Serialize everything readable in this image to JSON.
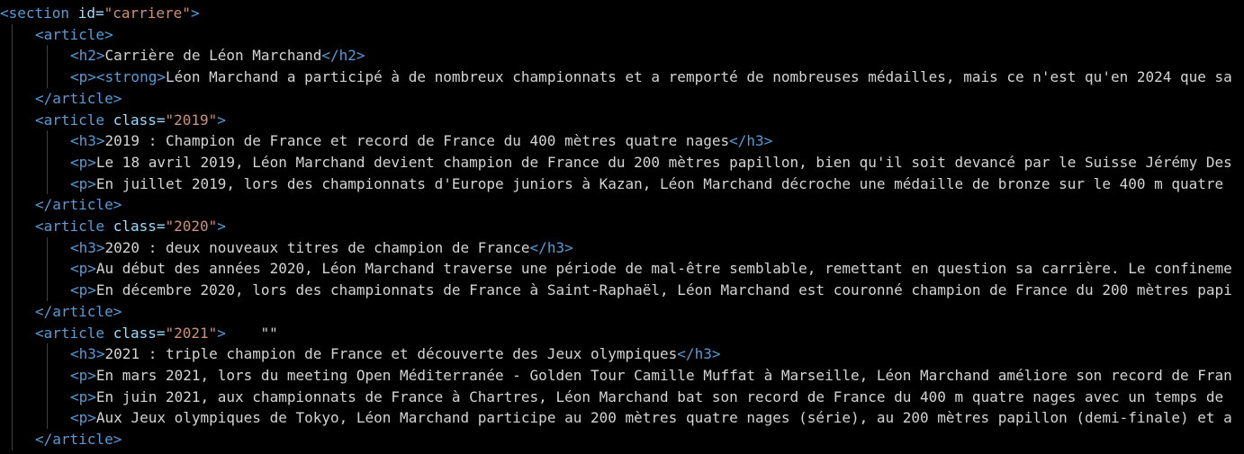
{
  "editor": {
    "lines": [
      {
        "indent": 0,
        "segments": [
          {
            "t": "<section ",
            "c": "tag"
          },
          {
            "t": "id=",
            "c": "attr"
          },
          {
            "t": "\"carriere\"",
            "c": "str"
          },
          {
            "t": ">",
            "c": "tag"
          }
        ]
      },
      {
        "indent": 1,
        "segments": [
          {
            "t": "<article>",
            "c": "tag"
          }
        ]
      },
      {
        "indent": 2,
        "segments": [
          {
            "t": "<h2>",
            "c": "tag"
          },
          {
            "t": "Carrière de Léon Marchand",
            "c": "txt"
          },
          {
            "t": "</h2>",
            "c": "tag"
          }
        ]
      },
      {
        "indent": 2,
        "segments": [
          {
            "t": "<p><strong>",
            "c": "tag"
          },
          {
            "t": "Léon Marchand a participé à de nombreux championnats et a remporté de nombreuses médailles, mais ce n'est qu'en 2024 que sa",
            "c": "txt"
          }
        ]
      },
      {
        "indent": 1,
        "segments": [
          {
            "t": "</article>",
            "c": "tag"
          }
        ]
      },
      {
        "indent": 1,
        "segments": [
          {
            "t": "<article ",
            "c": "tag"
          },
          {
            "t": "class=",
            "c": "attr"
          },
          {
            "t": "\"2019\"",
            "c": "str"
          },
          {
            "t": ">",
            "c": "tag"
          }
        ]
      },
      {
        "indent": 2,
        "segments": [
          {
            "t": "<h3>",
            "c": "tag"
          },
          {
            "t": "2019 : Champion de France et record de France du 400 mètres quatre nages",
            "c": "txt"
          },
          {
            "t": "</h3>",
            "c": "tag"
          }
        ]
      },
      {
        "indent": 2,
        "segments": [
          {
            "t": "<p>",
            "c": "tag"
          },
          {
            "t": "Le 18 avril 2019, Léon Marchand devient champion de France du 200 mètres papillon, bien qu'il soit devancé par le Suisse Jérémy Des",
            "c": "txt"
          }
        ]
      },
      {
        "indent": 2,
        "segments": [
          {
            "t": "<p>",
            "c": "tag"
          },
          {
            "t": "En juillet 2019, lors des championnats d'Europe juniors à Kazan, Léon Marchand décroche une médaille de bronze sur le 400 m quatre ",
            "c": "txt"
          }
        ]
      },
      {
        "indent": 1,
        "segments": [
          {
            "t": "</article>",
            "c": "tag"
          }
        ]
      },
      {
        "indent": 1,
        "segments": [
          {
            "t": "<article ",
            "c": "tag"
          },
          {
            "t": "class=",
            "c": "attr"
          },
          {
            "t": "\"2020\"",
            "c": "str"
          },
          {
            "t": ">",
            "c": "tag"
          }
        ]
      },
      {
        "indent": 2,
        "segments": [
          {
            "t": "<h3>",
            "c": "tag"
          },
          {
            "t": "2020 : deux nouveaux titres de champion de France",
            "c": "txt"
          },
          {
            "t": "</h3>",
            "c": "tag"
          }
        ]
      },
      {
        "indent": 2,
        "segments": [
          {
            "t": "<p>",
            "c": "tag"
          },
          {
            "t": "Au début des années 2020, Léon Marchand traverse une période de mal-être semblable, remettant en question sa carrière. Le confineme",
            "c": "txt"
          }
        ]
      },
      {
        "indent": 2,
        "segments": [
          {
            "t": "<p>",
            "c": "tag"
          },
          {
            "t": "En décembre 2020, lors des championnats de France à Saint-Raphaël, Léon Marchand est couronné champion de France du 200 mètres papi",
            "c": "txt"
          }
        ]
      },
      {
        "indent": 1,
        "segments": [
          {
            "t": "</article>",
            "c": "tag"
          }
        ]
      },
      {
        "indent": 1,
        "segments": [
          {
            "t": "<article ",
            "c": "tag"
          },
          {
            "t": "class=",
            "c": "attr"
          },
          {
            "t": "\"2021\"",
            "c": "str"
          },
          {
            "t": ">",
            "c": "tag"
          },
          {
            "t": "    \"\"",
            "c": "txt"
          }
        ]
      },
      {
        "indent": 2,
        "segments": [
          {
            "t": "<h3>",
            "c": "tag"
          },
          {
            "t": "2021 : triple champion de France et découverte des Jeux olympiques",
            "c": "txt"
          },
          {
            "t": "</h3>",
            "c": "tag"
          }
        ]
      },
      {
        "indent": 2,
        "segments": [
          {
            "t": "<p>",
            "c": "tag"
          },
          {
            "t": "En mars 2021, lors du meeting Open Méditerranée - Golden Tour Camille Muffat à Marseille, Léon Marchand améliore son record de Fran",
            "c": "txt"
          }
        ]
      },
      {
        "indent": 2,
        "segments": [
          {
            "t": "<p>",
            "c": "tag"
          },
          {
            "t": "En juin 2021, aux championnats de France à Chartres, Léon Marchand bat son record de France du 400 m quatre nages avec un temps de ",
            "c": "txt"
          }
        ]
      },
      {
        "indent": 2,
        "segments": [
          {
            "t": "<p>",
            "c": "tag"
          },
          {
            "t": "Aux Jeux olympiques de Tokyo, Léon Marchand participe au 200 mètres quatre nages (série), au 200 mètres papillon (demi-finale) et a",
            "c": "txt"
          }
        ]
      },
      {
        "indent": 1,
        "segments": [
          {
            "t": "</article>",
            "c": "tag"
          }
        ]
      }
    ]
  }
}
